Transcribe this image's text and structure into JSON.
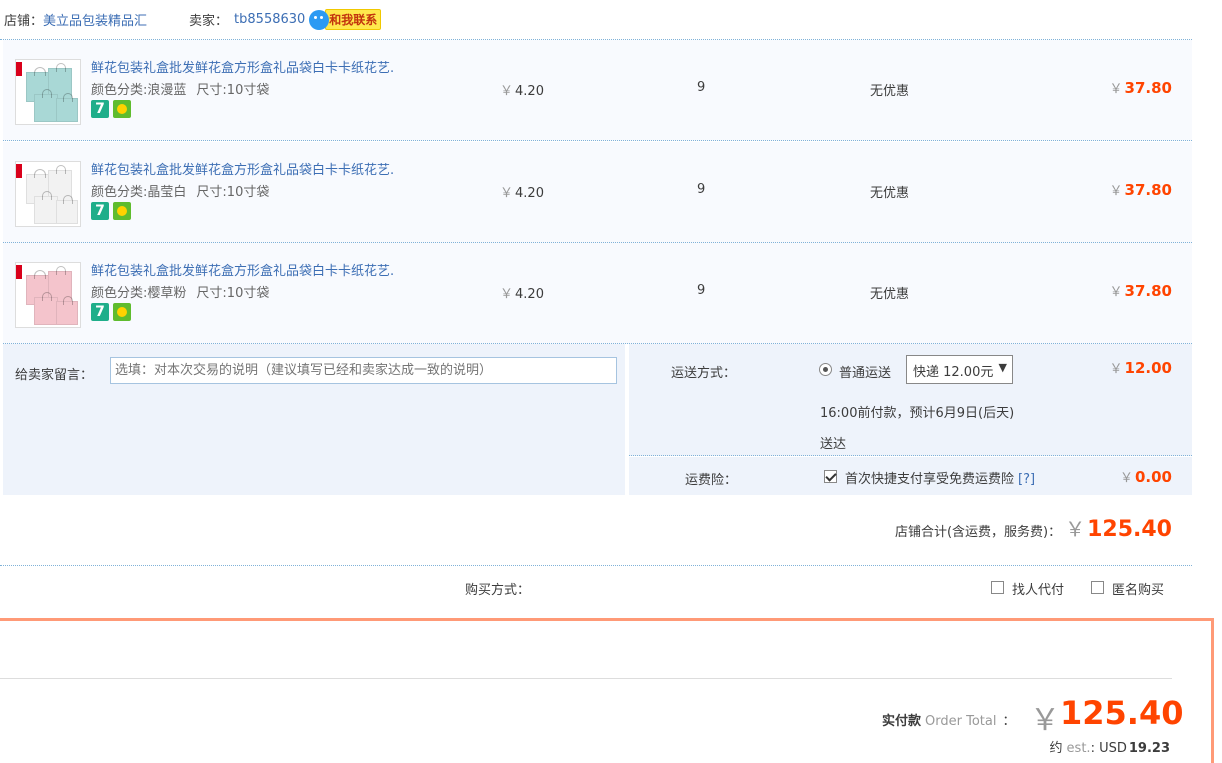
{
  "shop": {
    "shop_label": "店铺：",
    "shop_name": "美立品包装精品汇",
    "seller_label": "卖家：",
    "seller_name": "tb8558630",
    "contact_label": "和我联系"
  },
  "items": [
    {
      "title": "鲜花包装礼盒批发鲜花盒方形盒礼品袋白卡卡纸花艺.",
      "color_label": "颜色分类:",
      "color_value": "浪漫蓝",
      "size_label": "尺寸:",
      "size_value": "10寸袋",
      "badge": "7",
      "price_yen": "￥",
      "price": "4.20",
      "qty": "9",
      "promo": "无优惠",
      "subtotal_yen": "￥",
      "subtotal": "37.80",
      "thumb_color": "#a9d8d6"
    },
    {
      "title": "鲜花包装礼盒批发鲜花盒方形盒礼品袋白卡卡纸花艺.",
      "color_label": "颜色分类:",
      "color_value": "晶莹白",
      "size_label": "尺寸:",
      "size_value": "10寸袋",
      "badge": "7",
      "price_yen": "￥",
      "price": "4.20",
      "qty": "9",
      "promo": "无优惠",
      "subtotal_yen": "￥",
      "subtotal": "37.80",
      "thumb_color": "#f2f2f2"
    },
    {
      "title": "鲜花包装礼盒批发鲜花盒方形盒礼品袋白卡卡纸花艺.",
      "color_label": "颜色分类:",
      "color_value": "樱草粉",
      "size_label": "尺寸:",
      "size_value": "10寸袋",
      "badge": "7",
      "price_yen": "￥",
      "price": "4.20",
      "qty": "9",
      "promo": "无优惠",
      "subtotal_yen": "￥",
      "subtotal": "37.80",
      "thumb_color": "#f4c4cc"
    }
  ],
  "message": {
    "label": "给卖家留言：",
    "placeholder": "选填：对本次交易的说明（建议填写已经和卖家达成一致的说明）"
  },
  "shipping": {
    "label": "运送方式：",
    "option": "普通运送",
    "select_value": "快递 12.00元",
    "fee_yen": "￥",
    "fee": "12.00",
    "note1": "16:00前付款，预计6月9日(后天)",
    "note2": "送达"
  },
  "insurance": {
    "label": "运费险：",
    "text": "首次快捷支付享受免费运费险",
    "help": "[?]",
    "fee_yen": "￥",
    "fee": "0.00"
  },
  "shop_total": {
    "label": "店铺合计(含运费，服务费)：",
    "yen": "￥",
    "amount": "125.40"
  },
  "purchase": {
    "label": "购买方式：",
    "proxy": "找人代付",
    "anonymous": "匿名购买"
  },
  "order_total": {
    "label_cn": "实付款",
    "label_en": "Order Total",
    "colon": "：",
    "yen": "￥",
    "amount": "125.40",
    "approx": "约",
    "est": "est.",
    "usd_sep": ":",
    "currency": "USD",
    "usd_amount": "19.23"
  }
}
